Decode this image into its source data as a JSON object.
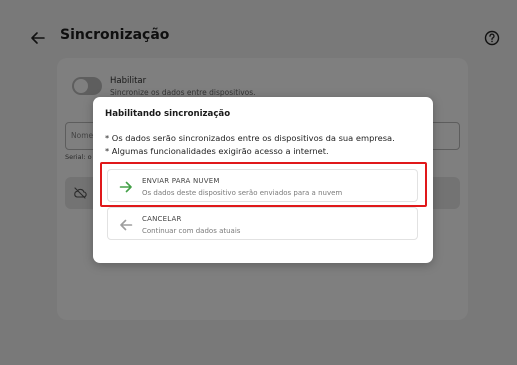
{
  "header": {
    "title": "Sincronização",
    "back_icon": "arrow-left-icon",
    "help_icon": "help-circle-icon"
  },
  "settings": {
    "enable_label": "Habilitar",
    "enable_description": "Sincronize os dados entre dispositivos.",
    "name_placeholder": "Nome",
    "serial_label": "Serial: o",
    "sync_icon": "cloud-off-icon"
  },
  "dialog": {
    "title": "Habilitando sincronização",
    "line1": "* Os dados serão sincronizados entre os dispositivos da sua empresa.",
    "line2": "* Algumas funcionalidades exigirão acesso a internet.",
    "options": [
      {
        "title": "ENVIAR PARA NUVEM",
        "description": "Os dados deste dispositivo serão enviados para a nuvem",
        "icon": "arrow-right-icon",
        "color": "#43a047"
      },
      {
        "title": "CANCELAR",
        "description": "Continuar com dados atuais",
        "icon": "arrow-left-icon",
        "color": "#9e9e9e"
      }
    ]
  },
  "colors": {
    "highlight": "#e0181a",
    "overlay": "rgba(0,0,0,0.5)"
  }
}
